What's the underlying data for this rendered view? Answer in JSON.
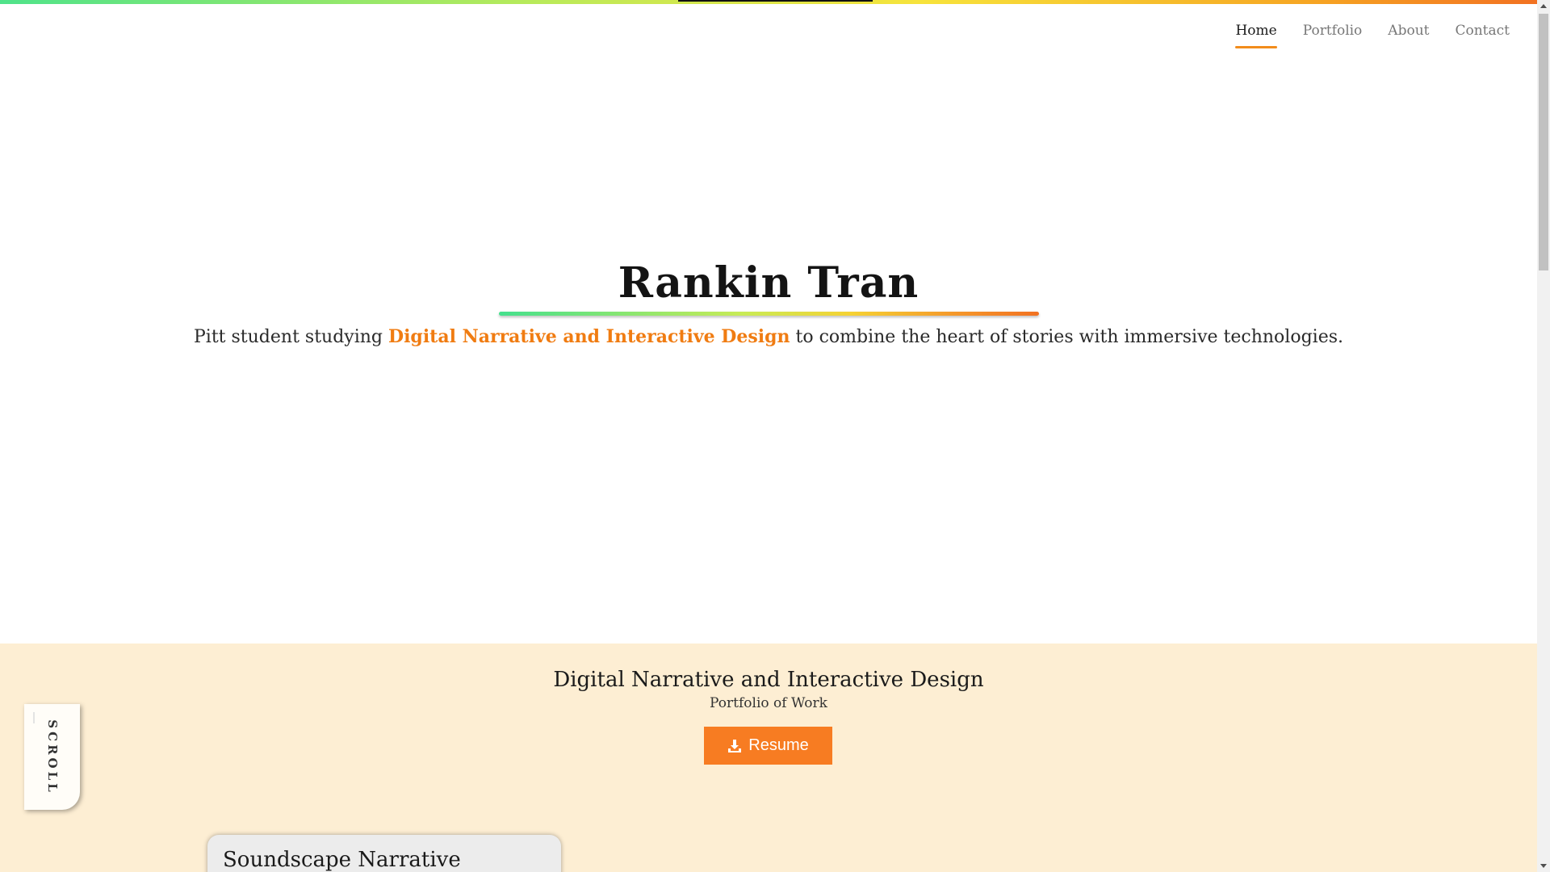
{
  "nav": {
    "items": [
      {
        "label": "Home",
        "active": true
      },
      {
        "label": "Portfolio",
        "active": false
      },
      {
        "label": "About",
        "active": false
      },
      {
        "label": "Contact",
        "active": false
      }
    ]
  },
  "hero": {
    "name": "Rankin Tran",
    "tagline_prefix": "Pitt student studying ",
    "tagline_highlight": "Digital Narrative and Interactive Design",
    "tagline_suffix": " to combine the heart of stories with immersive technologies."
  },
  "portfolio": {
    "title": "Digital Narrative and Interactive Design",
    "subtitle": "Portfolio of Work",
    "resume_label": "Resume",
    "resume_icon": "download-icon",
    "cards": [
      {
        "title": "Soundscape Narrative"
      }
    ]
  },
  "scroll_tab": {
    "label": "SCROLL"
  },
  "colors": {
    "accent": "#f77c22",
    "highlight": "#f07c12",
    "section_bg": "#fdeed3",
    "nav_active_underline": "#f28c1b"
  }
}
